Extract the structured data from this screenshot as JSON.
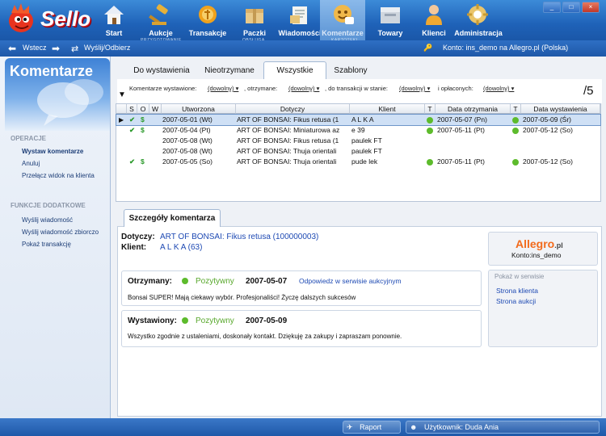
{
  "app": {
    "logo": "Sello",
    "nav": [
      {
        "label": "Start",
        "icon": "home-icon"
      },
      {
        "label": "Aukcje",
        "icon": "gavel-icon"
      },
      {
        "label": "Transakcje",
        "icon": "transaction-icon"
      },
      {
        "label": "Paczki",
        "icon": "package-icon"
      },
      {
        "label": "Wiadomości",
        "icon": "message-icon"
      },
      {
        "label": "Komentarze",
        "icon": "comments-icon"
      },
      {
        "label": "Towary",
        "icon": "goods-icon"
      },
      {
        "label": "Klienci",
        "icon": "client-icon"
      },
      {
        "label": "Administracja",
        "icon": "admin-icon"
      }
    ],
    "groups": {
      "prep": "PRZYGOTOWANIE",
      "service": "OBSŁUGA",
      "filing": "KARTOTEKI"
    },
    "window_buttons": [
      "_",
      "□",
      "×"
    ]
  },
  "navbar": {
    "back": "Wstecz",
    "send_receive": "Wyślij/Odbierz",
    "account": "Konto: ins_demo na Allegro.pl (Polska)"
  },
  "left": {
    "title": "Komentarze",
    "operations_header": "OPERACJE",
    "operations": [
      "Wystaw komentarze",
      "Anuluj",
      "Przełącz widok na klienta"
    ],
    "extra_header": "FUNKCJE DODATKOWE",
    "extra": [
      "Wyślij wiadomość",
      "Wyślij wiadomość zbiorczo",
      "Pokaż transakcję"
    ]
  },
  "tabs": [
    "Do wystawienia",
    "Nieotrzymane",
    "Wszystkie",
    "Szablony"
  ],
  "filters": {
    "issued_label": "Komentarze wystawione:",
    "issued_value": "(dowolny)",
    "received_label": ", otrzymane:",
    "received_value": "(dowolny)",
    "state_label": ", do transakcji w stanie:",
    "state_value": "(dowolny)",
    "paid_label": "i opłaconych:",
    "paid_value": "(dowolny)",
    "count": "/5"
  },
  "table": {
    "columns": [
      "S",
      "O",
      "W",
      "Utworzona",
      "Dotyczy",
      "Klient",
      "T",
      "Data otrzymania",
      "T",
      "Data wystawienia"
    ],
    "rows": [
      {
        "s": "✔",
        "o": "$",
        "w": "",
        "created": "2007-05-01 (Wt)",
        "about": "ART OF BONSAI: Fikus retusa (1",
        "client": "A L K A",
        "t1": true,
        "received": "2007-05-07 (Pn)",
        "t2": true,
        "issued": "2007-05-09 (Śr)"
      },
      {
        "s": "✔",
        "o": "$",
        "w": "",
        "created": "2007-05-04 (Pt)",
        "about": "ART OF BONSAI: Miniaturowa az",
        "client": "e 39",
        "t1": true,
        "received": "2007-05-11 (Pt)",
        "t2": true,
        "issued": "2007-05-12 (So)"
      },
      {
        "s": "",
        "o": "",
        "w": "",
        "created": "2007-05-08 (Wt)",
        "about": "ART OF BONSAI: Fikus retusa (1",
        "client": "paulek FT",
        "t1": false,
        "received": "",
        "t2": false,
        "issued": ""
      },
      {
        "s": "",
        "o": "",
        "w": "",
        "created": "2007-05-08 (Wt)",
        "about": "ART OF BONSAI: Thuja orientali",
        "client": "paulek FT",
        "t1": false,
        "received": "",
        "t2": false,
        "issued": ""
      },
      {
        "s": "✔",
        "o": "$",
        "w": "",
        "created": "2007-05-05 (So)",
        "about": "ART OF BONSAI: Thuja orientali",
        "client": "pude lek",
        "t1": true,
        "received": "2007-05-11 (Pt)",
        "t2": true,
        "issued": "2007-05-12 (So)"
      }
    ]
  },
  "detail": {
    "tab": "Szczegóły komentarza",
    "about_label": "Dotyczy:",
    "about_value": "ART OF BONSAI: Fikus retusa (100000003)",
    "client_label": "Klient:",
    "client_value": "A L K A (63)",
    "received_label": "Otrzymany:",
    "received_type": "Pozytywny",
    "received_date": "2007-05-07",
    "received_link": "Odpowiedz w serwisie aukcyjnym",
    "received_text": "Bonsai SUPER! Mają ciekawy wybór. Profesjonaliści! Życzę dalszych sukcesów",
    "issued_label": "Wystawiony:",
    "issued_type": "Pozytywny",
    "issued_date": "2007-05-09",
    "issued_text": "Wszystko zgodnie z ustaleniami, doskonały kontakt. Dziękuję za zakupy i zapraszam ponownie.",
    "allegro": "Allegro",
    "allegro_suffix": ".pl",
    "account": "Konto:ins_demo",
    "show_header": "Pokaż w serwisie",
    "show_client": "Strona klienta",
    "show_auction": "Strona aukcji"
  },
  "status": {
    "report": "Raport",
    "user": "Użytkownik: Duda Ania"
  }
}
